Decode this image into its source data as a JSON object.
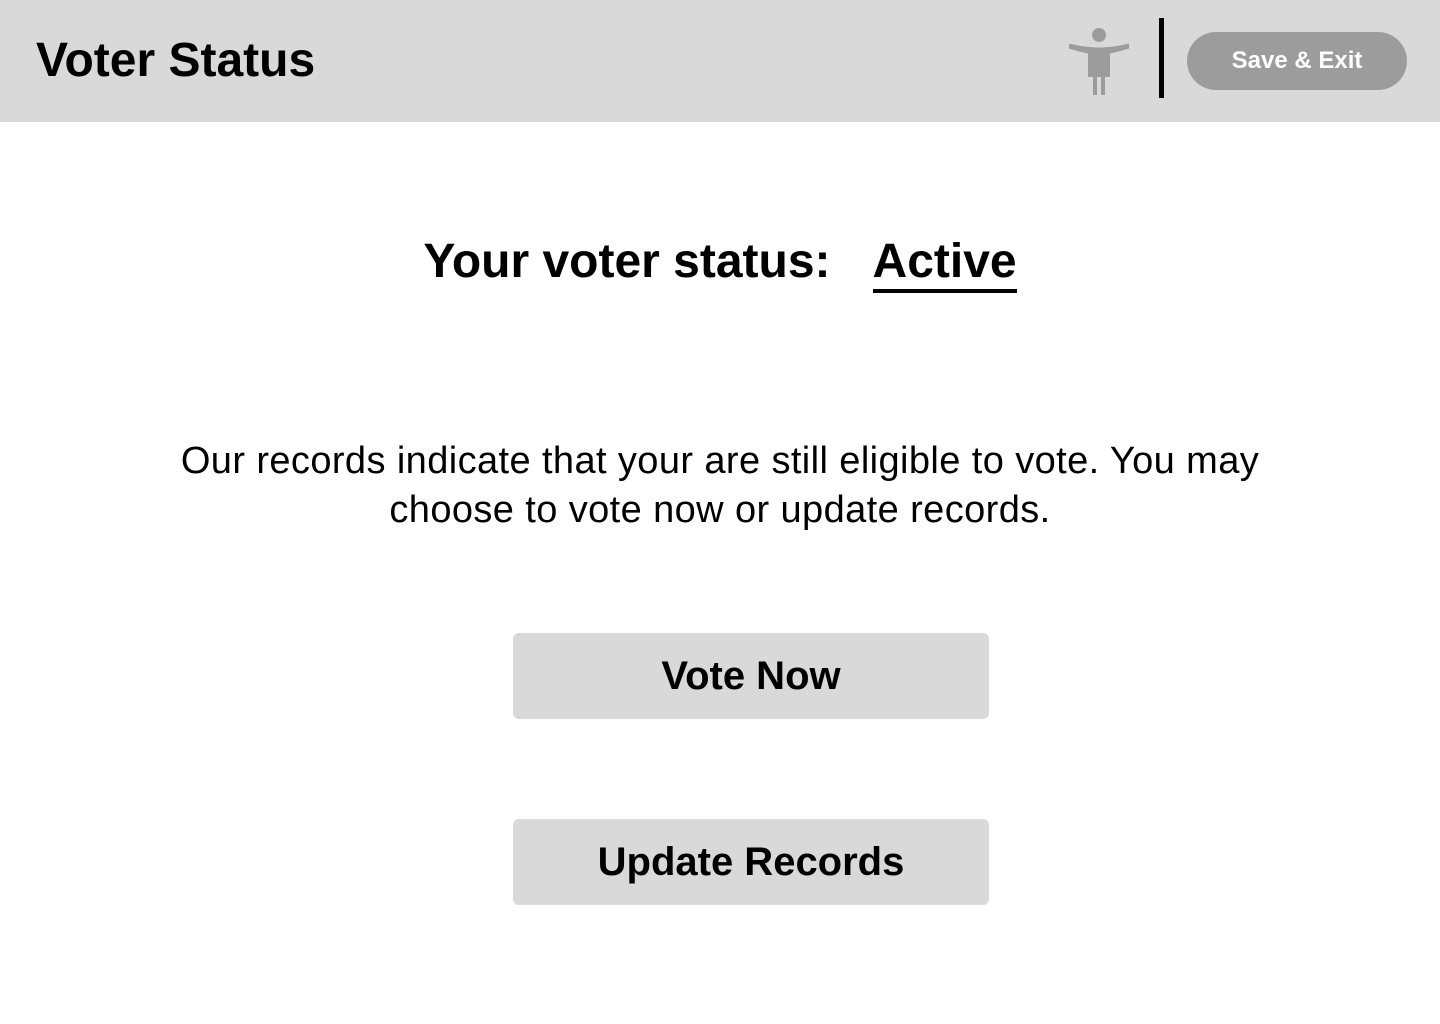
{
  "header": {
    "title": "Voter Status",
    "accessibility_icon": "accessibility-person-icon",
    "save_exit_label": "Save & Exit"
  },
  "status": {
    "label": "Your voter status:",
    "value": "Active"
  },
  "message": "Our records indicate that your are still eligible to vote. You may choose to vote now or update records.",
  "actions": {
    "vote_now_label": "Vote Now",
    "update_records_label": "Update Records"
  },
  "colors": {
    "header_background": "#d9d9d9",
    "button_background": "#d9d9d9",
    "save_exit_background": "#9c9c9c",
    "icon_color": "#9c9c9c",
    "text": "#000000"
  }
}
